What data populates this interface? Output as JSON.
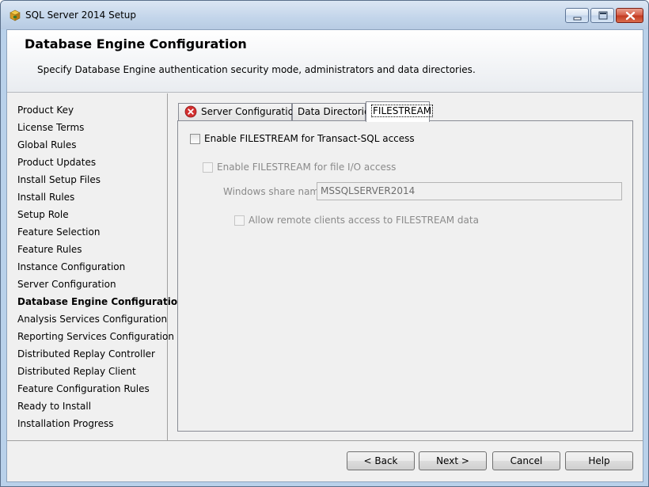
{
  "window": {
    "title": "SQL Server 2014 Setup"
  },
  "header": {
    "title": "Database Engine Configuration",
    "subtitle": "Specify Database Engine authentication security mode, administrators and data directories."
  },
  "nav": {
    "items": [
      {
        "label": "Product Key"
      },
      {
        "label": "License Terms"
      },
      {
        "label": "Global Rules"
      },
      {
        "label": "Product Updates"
      },
      {
        "label": "Install Setup Files"
      },
      {
        "label": "Install Rules"
      },
      {
        "label": "Setup Role"
      },
      {
        "label": "Feature Selection"
      },
      {
        "label": "Feature Rules"
      },
      {
        "label": "Instance Configuration"
      },
      {
        "label": "Server Configuration"
      },
      {
        "label": "Database Engine Configuration",
        "active": true
      },
      {
        "label": "Analysis Services Configuration"
      },
      {
        "label": "Reporting Services Configuration"
      },
      {
        "label": "Distributed Replay Controller"
      },
      {
        "label": "Distributed Replay Client"
      },
      {
        "label": "Feature Configuration Rules"
      },
      {
        "label": "Ready to Install"
      },
      {
        "label": "Installation Progress"
      }
    ]
  },
  "tabs": {
    "server_configuration": "Server Configuration",
    "data_directories": "Data Directories",
    "filestream": "FILESTREAM",
    "selected": "FILESTREAM"
  },
  "filestream": {
    "enable_tsql_label": "Enable FILESTREAM for Transact-SQL access",
    "enable_tsql_checked": false,
    "enable_file_io_label": "Enable FILESTREAM for file I/O access",
    "enable_file_io_checked": false,
    "share_name_label": "Windows share name:",
    "share_name_value": "MSSQLSERVER2014",
    "allow_remote_label": "Allow remote clients access to FILESTREAM data",
    "allow_remote_checked": false
  },
  "footer": {
    "back_label": "< Back",
    "next_label": "Next >",
    "cancel_label": "Cancel",
    "help_label": "Help"
  },
  "icons": {
    "app": "sql-setup-box-icon",
    "tab_error": "error-icon"
  },
  "colors": {
    "error_red": "#d32f2f",
    "titlebar": "#c3d5ea",
    "close_button": "#c0391f"
  }
}
